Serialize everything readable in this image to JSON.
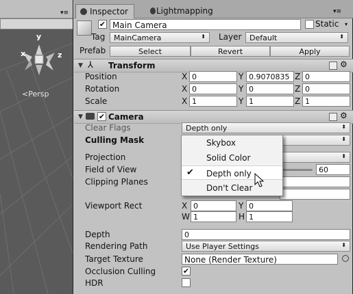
{
  "scene": {
    "persp_label": "<Persp",
    "axis_y": "y",
    "axis_x": "x",
    "axis_z": "z"
  },
  "tabs": [
    {
      "label": "Inspector"
    },
    {
      "label": "Lightmapping"
    }
  ],
  "object": {
    "name": "Main Camera",
    "active": true,
    "static_label": "Static",
    "static_checked": false,
    "tag_label": "Tag",
    "tag_value": "MainCamera",
    "layer_label": "Layer",
    "layer_value": "Default",
    "prefab_label": "Prefab",
    "prefab_buttons": [
      "Select",
      "Revert",
      "Apply"
    ]
  },
  "transform": {
    "title": "Transform",
    "rows": [
      {
        "label": "Position",
        "x": "0",
        "y": "0.9070835",
        "z": "0"
      },
      {
        "label": "Rotation",
        "x": "0",
        "y": "0",
        "z": "0"
      },
      {
        "label": "Scale",
        "x": "1",
        "y": "1",
        "z": "1"
      }
    ],
    "axes": [
      "X",
      "Y",
      "Z"
    ]
  },
  "camera": {
    "title": "Camera",
    "enabled": true,
    "clear_flags_label": "Clear Flags",
    "clear_flags_value": "Depth only",
    "culling_mask_label": "Culling Mask",
    "projection_label": "Projection",
    "fov_label": "Field of View",
    "fov_value": "60",
    "clipping_label": "Clipping Planes",
    "viewport_label": "Viewport Rect",
    "viewport": {
      "x": "0",
      "y": "0",
      "w": "1",
      "h": "1"
    },
    "viewport_axes": [
      "X",
      "Y",
      "W",
      "H"
    ],
    "depth_label": "Depth",
    "depth_value": "0",
    "rendering_path_label": "Rendering Path",
    "rendering_path_value": "Use Player Settings",
    "target_texture_label": "Target Texture",
    "target_texture_value": "None (Render Texture)",
    "occlusion_label": "Occlusion Culling",
    "occlusion_checked": true,
    "hdr_label": "HDR",
    "hdr_checked": false
  },
  "popup": {
    "options": [
      "Skybox",
      "Solid Color",
      "Depth only",
      "Don't Clear"
    ],
    "selected": "Depth only"
  },
  "colors": {
    "scene_bg": "#5a5a5a",
    "panel_bg": "#c2c2c2",
    "disabled_label": "#555555"
  }
}
